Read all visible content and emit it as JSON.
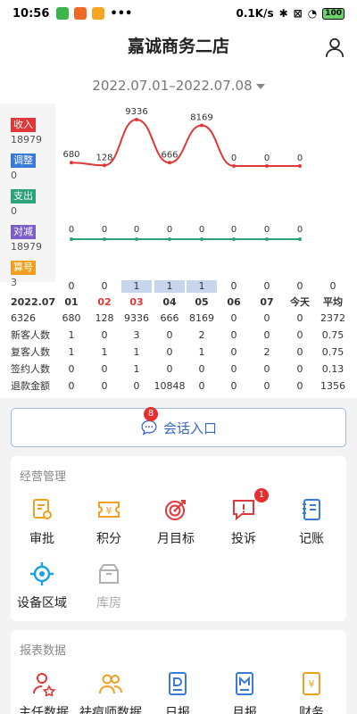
{
  "status_bar": {
    "time": "10:56",
    "network_speed": "0.1K/s",
    "battery": "100",
    "dots": "•••"
  },
  "header": {
    "title": "嘉诚商务二店"
  },
  "date_range": {
    "text": "2022.07.01–2022.07.08"
  },
  "legend": [
    {
      "label": "收入",
      "value": "18979",
      "color": "#e03838"
    },
    {
      "label": "调整",
      "value": "0",
      "color": "#3a7ad8"
    },
    {
      "label": "支出",
      "value": "0",
      "color": "#2ba27a"
    },
    {
      "label": "对减",
      "value": "18979",
      "color": "#7b5fc7"
    },
    {
      "label": "算号",
      "value": "3",
      "color": "#f0a020"
    }
  ],
  "chart_data": {
    "type": "line",
    "x": [
      "01",
      "02",
      "03",
      "04",
      "05",
      "06",
      "07",
      "今天"
    ],
    "series": [
      {
        "values": [
          680,
          128,
          9336,
          666,
          8169,
          0,
          0,
          0
        ],
        "color": "#e03838"
      },
      {
        "values": [
          0,
          0,
          0,
          0,
          0,
          0,
          0,
          0
        ],
        "color": "#2ba27a"
      }
    ],
    "bars": {
      "values": [
        0,
        0,
        1,
        1,
        1,
        0,
        0,
        0
      ],
      "color": "#c7d6ec"
    }
  },
  "table": {
    "count_row": {
      "cells": [
        "0",
        "0",
        "1",
        "1",
        "1",
        "0",
        "0",
        "0",
        "0"
      ]
    },
    "header_row": {
      "label": "2022.07",
      "cells": [
        "01",
        "02",
        "03",
        "04",
        "05",
        "06",
        "07",
        "今天",
        "平均"
      ]
    },
    "rows": [
      {
        "label": "6326",
        "cells": [
          "680",
          "128",
          "9336",
          "666",
          "8169",
          "0",
          "0",
          "0",
          "2372"
        ]
      },
      {
        "label": "新客人数",
        "cells": [
          "1",
          "0",
          "3",
          "0",
          "2",
          "0",
          "0",
          "0",
          "0.75"
        ]
      },
      {
        "label": "复客人数",
        "cells": [
          "1",
          "1",
          "1",
          "0",
          "1",
          "0",
          "2",
          "0",
          "0.75"
        ]
      },
      {
        "label": "签约人数",
        "cells": [
          "0",
          "0",
          "1",
          "0",
          "0",
          "0",
          "0",
          "0",
          "0.13"
        ]
      },
      {
        "label": "退款金额",
        "cells": [
          "0",
          "0",
          "0",
          "10848",
          "0",
          "0",
          "0",
          "0",
          "1356"
        ]
      }
    ]
  },
  "session": {
    "label": "会话入口",
    "badge": "8"
  },
  "management": {
    "title": "经营管理",
    "items": [
      {
        "label": "审批",
        "icon": "approval-icon"
      },
      {
        "label": "积分",
        "icon": "points-icon"
      },
      {
        "label": "月目标",
        "icon": "target-icon"
      },
      {
        "label": "投诉",
        "icon": "complaint-icon",
        "badge": "1"
      },
      {
        "label": "记账",
        "icon": "ledger-icon"
      },
      {
        "label": "设备区域",
        "icon": "device-area-icon"
      },
      {
        "label": "库房",
        "icon": "warehouse-icon"
      }
    ]
  },
  "reports": {
    "title": "报表数据",
    "items": [
      {
        "label": "主任数据",
        "icon": "director-icon"
      },
      {
        "label": "祛痘师数据",
        "icon": "therapist-icon"
      },
      {
        "label": "日报",
        "icon": "daily-report-icon"
      },
      {
        "label": "月报",
        "icon": "monthly-report-icon"
      },
      {
        "label": "财务",
        "icon": "finance-icon"
      }
    ]
  }
}
